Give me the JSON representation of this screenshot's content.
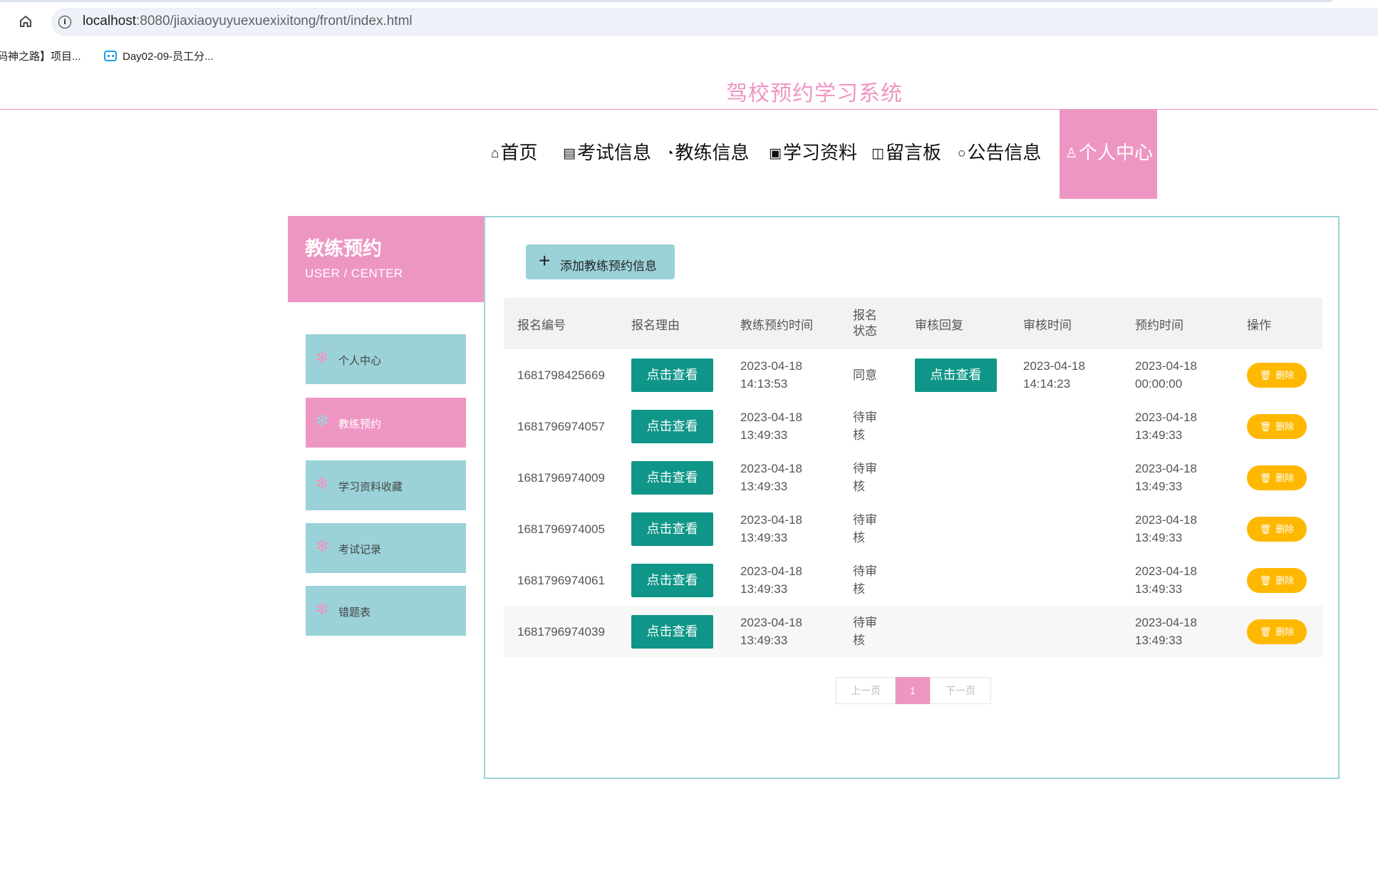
{
  "browser": {
    "url_host": "localhost",
    "url_path": ":8080/jiaxiaoyuyuexuexixitong/front/index.html",
    "bookmarks": [
      "码神之路】项目...",
      "Day02-09-员工分..."
    ]
  },
  "site": {
    "title": "驾校预约学习系统",
    "nav": [
      {
        "icon": "⌂",
        "label": "首页"
      },
      {
        "icon": "▤",
        "label": "考试信息"
      },
      {
        "icon": "◔",
        "label": "教练信息"
      },
      {
        "icon": "▣",
        "label": "学习资料"
      },
      {
        "icon": "◫",
        "label": "留言板"
      },
      {
        "icon": "○",
        "label": "公告信息"
      },
      {
        "icon": "♙",
        "label": "个人中心"
      }
    ]
  },
  "sidebar": {
    "title": "教练预约",
    "subtitle": "USER / CENTER",
    "items": [
      {
        "label": "个人中心"
      },
      {
        "label": "教练预约"
      },
      {
        "label": "学习资料收藏"
      },
      {
        "label": "考试记录"
      },
      {
        "label": "错题表"
      }
    ]
  },
  "main": {
    "add_button": "添加教练预约信息",
    "columns": [
      "报名编号",
      "报名理由",
      "教练预约时间",
      "报名状态",
      "审核回复",
      "审核时间",
      "预约时间",
      "操作"
    ],
    "view_label": "点击查看",
    "delete_label": "删除",
    "rows": [
      {
        "id": "1681798425669",
        "coach_date": "2023-04-18",
        "coach_time": "14:13:53",
        "status": "同意",
        "has_reply": true,
        "review_date": "2023-04-18",
        "review_time": "14:14:23",
        "book_date": "2023-04-18",
        "book_time": "00:00:00"
      },
      {
        "id": "1681796974057",
        "coach_date": "2023-04-18",
        "coach_time": "13:49:33",
        "status": "待审核",
        "has_reply": false,
        "review_date": "",
        "review_time": "",
        "book_date": "2023-04-18",
        "book_time": "13:49:33"
      },
      {
        "id": "1681796974009",
        "coach_date": "2023-04-18",
        "coach_time": "13:49:33",
        "status": "待审核",
        "has_reply": false,
        "review_date": "",
        "review_time": "",
        "book_date": "2023-04-18",
        "book_time": "13:49:33"
      },
      {
        "id": "1681796974005",
        "coach_date": "2023-04-18",
        "coach_time": "13:49:33",
        "status": "待审核",
        "has_reply": false,
        "review_date": "",
        "review_time": "",
        "book_date": "2023-04-18",
        "book_time": "13:49:33"
      },
      {
        "id": "1681796974061",
        "coach_date": "2023-04-18",
        "coach_time": "13:49:33",
        "status": "待审核",
        "has_reply": false,
        "review_date": "",
        "review_time": "",
        "book_date": "2023-04-18",
        "book_time": "13:49:33"
      },
      {
        "id": "1681796974039",
        "coach_date": "2023-04-18",
        "coach_time": "13:49:33",
        "status": "待审核",
        "has_reply": false,
        "review_date": "",
        "review_time": "",
        "book_date": "2023-04-18",
        "book_time": "13:49:33"
      }
    ],
    "pager": {
      "prev": "上一页",
      "current": "1",
      "next": "下一页"
    }
  },
  "colors": {
    "pink": "#ee96c3",
    "teal": "#9ad2d8",
    "green": "#0f9688",
    "amber": "#ffb800"
  }
}
